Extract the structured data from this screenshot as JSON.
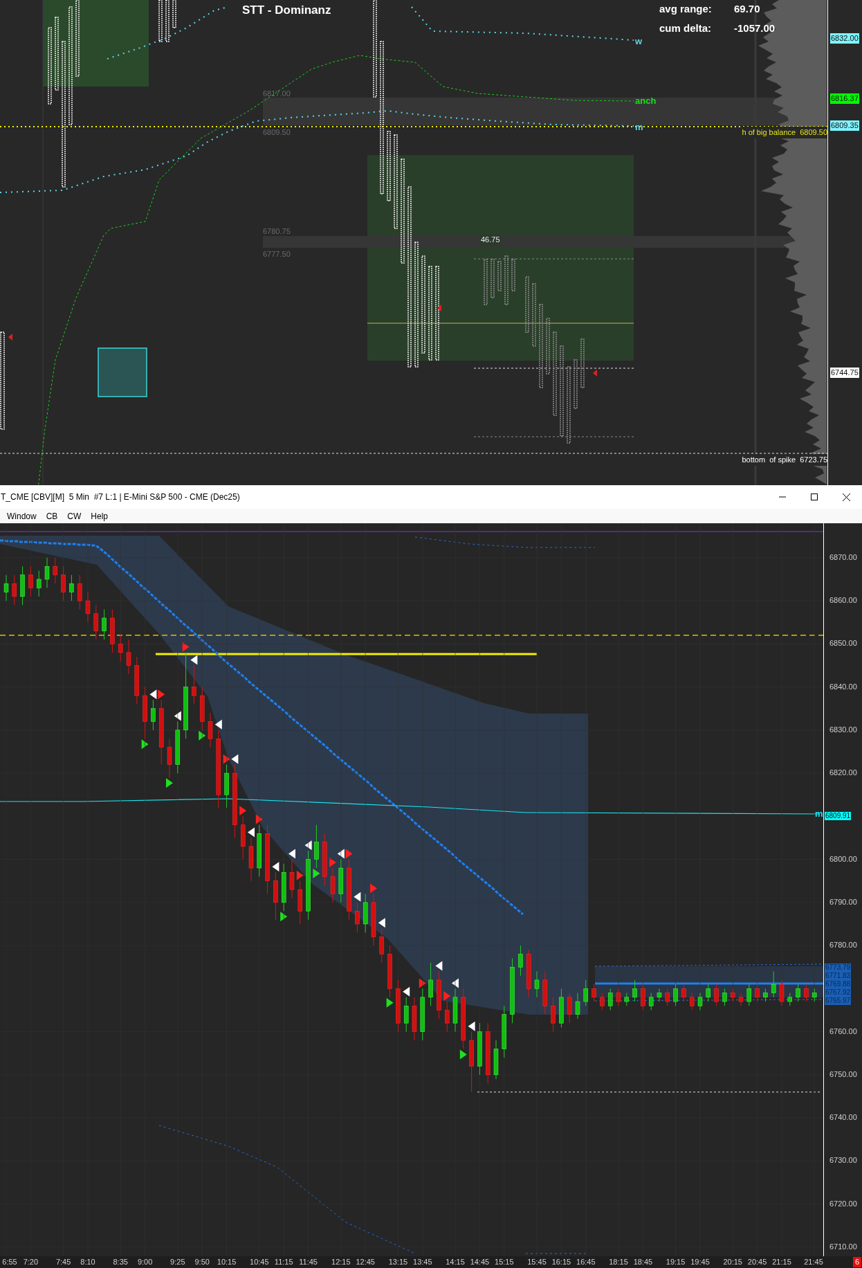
{
  "top_chart": {
    "title": "STT - Dominanz",
    "stats": [
      {
        "label": "avg range:",
        "value": "69.70"
      },
      {
        "label": "cum delta:",
        "value": "-1057.00"
      }
    ],
    "line_labels": [
      {
        "text": "w",
        "color": "#5fd7e6"
      },
      {
        "text": "anch",
        "color": "#19e019"
      },
      {
        "text": "m",
        "color": "#5fd7e6"
      }
    ],
    "level_labels": [
      "6817.00",
      "6809.50",
      "6780.75",
      "6777.50"
    ],
    "range_label": "46.75",
    "annotations": [
      {
        "text": "h of big balance  6809.50",
        "color": "#e6e619"
      },
      {
        "text": "bottom  of spike  6723.75",
        "color": "#ffffff"
      }
    ],
    "price_tags": [
      {
        "text": "6832.00",
        "color": "#7ff4ff"
      },
      {
        "text": "6816.37",
        "color": "#00ff00"
      },
      {
        "text": "6809.35",
        "color": "#7ff4ff"
      },
      {
        "text": "6744.75",
        "color": "#ffffff"
      }
    ]
  },
  "window": {
    "title": "T_CME [CBV][M]  5 Min  #7 L:1 | E-Mini S&P 500 - CME (Dec25)",
    "menu": [
      "Window",
      "CB",
      "CW",
      "Help"
    ]
  },
  "bottom_chart": {
    "chart_data": {
      "type": "candlestick",
      "categories": [
        "6:55",
        null,
        null,
        "7:20",
        null,
        null,
        null,
        "7:45",
        null,
        null,
        "8:10",
        null,
        null,
        null,
        "8:35",
        null,
        null,
        "9:00",
        null,
        null,
        null,
        "9:25",
        null,
        null,
        "9:50",
        null,
        null,
        "10:15",
        null,
        null,
        null,
        "10:45",
        null,
        null,
        "11:15",
        null,
        null,
        "11:45",
        null,
        null,
        null,
        "12:15",
        null,
        null,
        "12:45",
        null,
        null,
        null,
        "13:15",
        null,
        null,
        "13:45",
        null,
        null,
        null,
        "14:15",
        null,
        null,
        "14:45",
        null,
        null,
        "15:15",
        null,
        null,
        null,
        "15:45",
        null,
        null,
        "16:15",
        null,
        null,
        "16:45",
        null,
        null,
        null,
        "18:15",
        null,
        null,
        "18:45",
        null,
        null,
        null,
        "19:15",
        null,
        null,
        "19:45",
        null,
        null,
        null,
        "20:15",
        null,
        null,
        "20:45",
        null,
        null,
        "21:15",
        null,
        null,
        null,
        "21:45"
      ],
      "ohlc": [
        [
          6862,
          6866,
          6860,
          6864
        ],
        [
          6864,
          6866,
          6859,
          6861
        ],
        [
          6861,
          6868,
          6859,
          6866
        ],
        [
          6866,
          6868,
          6861,
          6863
        ],
        [
          6863,
          6867,
          6861,
          6865
        ],
        [
          6865,
          6870,
          6863,
          6868
        ],
        [
          6868,
          6870,
          6864,
          6866
        ],
        [
          6866,
          6868,
          6860,
          6862
        ],
        [
          6862,
          6866,
          6860,
          6864
        ],
        [
          6864,
          6866,
          6858,
          6860
        ],
        [
          6860,
          6862,
          6855,
          6857
        ],
        [
          6857,
          6859,
          6851,
          6853
        ],
        [
          6853,
          6858,
          6851,
          6856
        ],
        [
          6856,
          6858,
          6848,
          6850
        ],
        [
          6850,
          6852,
          6846,
          6848
        ],
        [
          6848,
          6851,
          6843,
          6845
        ],
        [
          6845,
          6847,
          6836,
          6838
        ],
        [
          6838,
          6840,
          6828,
          6832
        ],
        [
          6832,
          6837,
          6830,
          6835
        ],
        [
          6835,
          6837,
          6822,
          6826
        ],
        [
          6826,
          6828,
          6819,
          6822
        ],
        [
          6822,
          6832,
          6820,
          6830
        ],
        [
          6830,
          6848,
          6828,
          6840
        ],
        [
          6840,
          6845,
          6836,
          6838
        ],
        [
          6838,
          6840,
          6830,
          6832
        ],
        [
          6832,
          6834,
          6826,
          6828
        ],
        [
          6828,
          6830,
          6812,
          6815
        ],
        [
          6815,
          6822,
          6812,
          6820
        ],
        [
          6820,
          6822,
          6805,
          6808
        ],
        [
          6808,
          6810,
          6800,
          6803
        ],
        [
          6803,
          6805,
          6795,
          6798
        ],
        [
          6798,
          6808,
          6796,
          6806
        ],
        [
          6806,
          6808,
          6792,
          6795
        ],
        [
          6795,
          6797,
          6786,
          6790
        ],
        [
          6790,
          6799,
          6788,
          6797
        ],
        [
          6797,
          6800,
          6791,
          6793
        ],
        [
          6793,
          6795,
          6785,
          6788
        ],
        [
          6788,
          6802,
          6786,
          6800
        ],
        [
          6800,
          6808,
          6798,
          6804
        ],
        [
          6804,
          6806,
          6794,
          6796
        ],
        [
          6796,
          6798,
          6790,
          6792
        ],
        [
          6792,
          6800,
          6790,
          6798
        ],
        [
          6798,
          6800,
          6786,
          6788
        ],
        [
          6788,
          6790,
          6783,
          6785
        ],
        [
          6785,
          6792,
          6783,
          6790
        ],
        [
          6790,
          6792,
          6780,
          6782
        ],
        [
          6782,
          6784,
          6776,
          6778
        ],
        [
          6778,
          6780,
          6768,
          6770
        ],
        [
          6770,
          6772,
          6760,
          6762
        ],
        [
          6762,
          6768,
          6760,
          6766
        ],
        [
          6766,
          6768,
          6758,
          6760
        ],
        [
          6760,
          6770,
          6758,
          6768
        ],
        [
          6768,
          6776,
          6766,
          6772
        ],
        [
          6772,
          6774,
          6763,
          6765
        ],
        [
          6765,
          6767,
          6760,
          6762
        ],
        [
          6762,
          6770,
          6760,
          6768
        ],
        [
          6768,
          6770,
          6756,
          6758
        ],
        [
          6758,
          6760,
          6746,
          6752
        ],
        [
          6752,
          6762,
          6750,
          6760
        ],
        [
          6760,
          6762,
          6748,
          6750
        ],
        [
          6750,
          6758,
          6749,
          6756
        ],
        [
          6756,
          6766,
          6754,
          6764
        ],
        [
          6764,
          6777,
          6762,
          6775
        ],
        [
          6775,
          6780,
          6773,
          6778
        ],
        [
          6778,
          6779,
          6768,
          6770
        ],
        [
          6770,
          6774,
          6768,
          6772
        ],
        [
          6772,
          6774,
          6764,
          6766
        ],
        [
          6766,
          6768,
          6760,
          6762
        ],
        [
          6762,
          6770,
          6761,
          6768
        ],
        [
          6768,
          6769,
          6762,
          6764
        ],
        [
          6764,
          6769,
          6763,
          6767
        ],
        [
          6767,
          6772,
          6766,
          6770
        ],
        [
          6770,
          6771,
          6767,
          6768
        ],
        [
          6768,
          6769,
          6765,
          6766
        ],
        [
          6766,
          6770,
          6765,
          6769
        ],
        [
          6769,
          6770,
          6766,
          6767
        ],
        [
          6767,
          6769,
          6766,
          6768
        ],
        [
          6768,
          6772,
          6767,
          6770
        ],
        [
          6770,
          6771,
          6765,
          6766
        ],
        [
          6766,
          6769,
          6765,
          6768
        ],
        [
          6768,
          6770,
          6767,
          6769
        ],
        [
          6769,
          6770,
          6766,
          6767
        ],
        [
          6767,
          6771,
          6766,
          6770
        ],
        [
          6770,
          6771,
          6767,
          6768
        ],
        [
          6768,
          6769,
          6765,
          6766
        ],
        [
          6766,
          6769,
          6765,
          6768
        ],
        [
          6768,
          6771,
          6767,
          6770
        ],
        [
          6770,
          6771,
          6766,
          6767
        ],
        [
          6767,
          6770,
          6766,
          6769
        ],
        [
          6769,
          6770,
          6767,
          6768
        ],
        [
          6768,
          6769,
          6766,
          6767
        ],
        [
          6767,
          6771,
          6766,
          6770
        ],
        [
          6770,
          6771,
          6767,
          6768
        ],
        [
          6768,
          6770,
          6767,
          6769
        ],
        [
          6769,
          6774,
          6768,
          6771
        ],
        [
          6771,
          6772,
          6766,
          6767
        ],
        [
          6767,
          6769,
          6766,
          6768
        ],
        [
          6768,
          6771,
          6767,
          6770
        ],
        [
          6770,
          6771,
          6767,
          6768
        ],
        [
          6768,
          6770,
          6767,
          6769
        ]
      ],
      "ylim": [
        6707.9,
        6878
      ],
      "yticks": [
        {
          "value": 6870,
          "label": "6870.00"
        },
        {
          "value": 6860,
          "label": "6860.00"
        },
        {
          "value": 6850,
          "label": "6850.00"
        },
        {
          "value": 6840,
          "label": "6840.00"
        },
        {
          "value": 6830,
          "label": "6830.00"
        },
        {
          "value": 6820,
          "label": "6820.00"
        },
        {
          "value": 6800,
          "label": "6800.00"
        },
        {
          "value": 6790,
          "label": "6790.00"
        },
        {
          "value": 6780,
          "label": "6780.00"
        },
        {
          "value": 6760,
          "label": "6760.00"
        },
        {
          "value": 6750,
          "label": "6750.00"
        },
        {
          "value": 6740,
          "label": "6740.00"
        },
        {
          "value": 6730,
          "label": "6730.00"
        },
        {
          "value": 6720,
          "label": "6720.00"
        },
        {
          "value": 6710,
          "label": "6710.00"
        }
      ],
      "grid": true
    },
    "line_label": {
      "text": "m",
      "color": "#19e6f0"
    },
    "price_tags": [
      {
        "text": "6809.91",
        "color": "#00ffff"
      },
      {
        "text": "6773.79",
        "color": "#1a5fb4"
      },
      {
        "text": "6771.83",
        "color": "#1a5fb4"
      },
      {
        "text": "6769.88",
        "color": "#1a5fb4"
      },
      {
        "text": "6767.92",
        "color": "#1a5fb4"
      },
      {
        "text": "6765.97",
        "color": "#1a5fb4"
      }
    ],
    "alert_badge": "6"
  }
}
